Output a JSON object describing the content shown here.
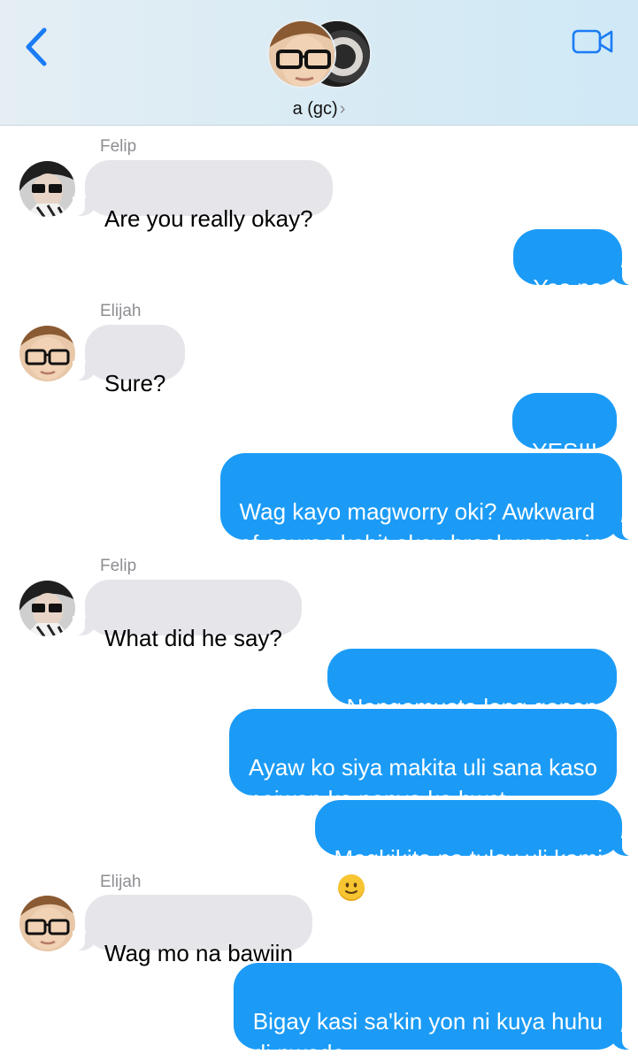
{
  "header": {
    "group_name": "a (gc)",
    "chevron": "›",
    "back_icon": "chevron-left-icon",
    "video_icon": "video-camera-icon",
    "accent": "#1a7cf5"
  },
  "colors": {
    "incoming_bubble": "#e5e5ea",
    "outgoing_bubble": "#1b9bf6",
    "sender_name": "#8e8e93"
  },
  "messages": [
    {
      "sender": "Felip",
      "direction": "in",
      "text": "Are you really okay?"
    },
    {
      "direction": "out",
      "text": "Yes po"
    },
    {
      "sender": "Elijah",
      "direction": "in",
      "text": "Sure?"
    },
    {
      "direction": "out",
      "text": "YES!!!"
    },
    {
      "direction": "out",
      "text": "Wag kayo magworry oki? Awkward\nof course kahit okay breakup namin"
    },
    {
      "sender": "Felip",
      "direction": "in",
      "text": "What did he say?"
    },
    {
      "direction": "out",
      "text": "Nangamusta lang ganon"
    },
    {
      "direction": "out",
      "text": "Ayaw ko siya makita uli sana kaso\nnaiwan ko panyo ko bwct"
    },
    {
      "direction": "out",
      "text": "Magkikita pa tuloy uli kami",
      "emoji": "slightly-smiling-face"
    },
    {
      "sender": "Elijah",
      "direction": "in",
      "text": "Wag mo na bawiin"
    },
    {
      "direction": "out",
      "text": "Bigay kasi sa'kin yon ni kuya huhu\ndi pwede"
    }
  ]
}
